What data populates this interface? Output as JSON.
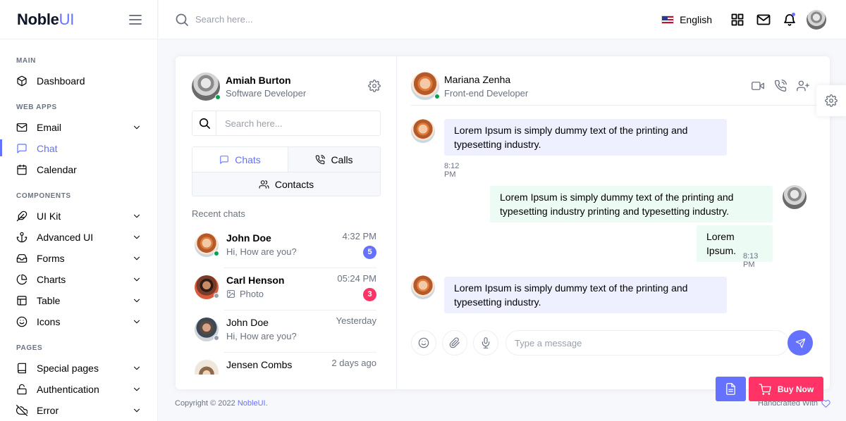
{
  "brand": {
    "name": "Noble",
    "suffix": "UI"
  },
  "sidebar": {
    "sections": [
      {
        "title": "MAIN",
        "items": [
          {
            "label": "Dashboard",
            "icon": "box-icon",
            "chevron": false
          }
        ]
      },
      {
        "title": "WEB APPS",
        "items": [
          {
            "label": "Email",
            "icon": "mail-icon",
            "chevron": true
          },
          {
            "label": "Chat",
            "icon": "message-square-icon",
            "chevron": false,
            "active": true
          },
          {
            "label": "Calendar",
            "icon": "calendar-icon",
            "chevron": false
          }
        ]
      },
      {
        "title": "COMPONENTS",
        "items": [
          {
            "label": "UI Kit",
            "icon": "feather-icon",
            "chevron": true
          },
          {
            "label": "Advanced UI",
            "icon": "anchor-icon",
            "chevron": true
          },
          {
            "label": "Forms",
            "icon": "inbox-icon",
            "chevron": true
          },
          {
            "label": "Charts",
            "icon": "pie-chart-icon",
            "chevron": true
          },
          {
            "label": "Table",
            "icon": "layout-icon",
            "chevron": true
          },
          {
            "label": "Icons",
            "icon": "smile-icon",
            "chevron": true
          }
        ]
      },
      {
        "title": "PAGES",
        "items": [
          {
            "label": "Special pages",
            "icon": "book-icon",
            "chevron": true
          },
          {
            "label": "Authentication",
            "icon": "unlock-icon",
            "chevron": true
          },
          {
            "label": "Error",
            "icon": "cloud-off-icon",
            "chevron": true
          }
        ]
      }
    ]
  },
  "topbar": {
    "search_placeholder": "Search here...",
    "language": "English"
  },
  "profile": {
    "name": "Amiah Burton",
    "role": "Software Developer"
  },
  "chat_search": {
    "placeholder": "Search here..."
  },
  "tabs": {
    "chats": "Chats",
    "calls": "Calls",
    "contacts": "Contacts"
  },
  "recent_label": "Recent chats",
  "chats": [
    {
      "name": "John Doe",
      "message": "Hi, How are you?",
      "time": "4:32 PM",
      "badge": "5",
      "badge_color": "#6571ff",
      "bold": true,
      "online": true,
      "avatar": "av-woman",
      "photo": false
    },
    {
      "name": "Carl Henson",
      "message": "Photo",
      "time": "05:24 PM",
      "badge": "3",
      "badge_color": "#ff3366",
      "bold": true,
      "online": false,
      "avatar": "av-man",
      "photo": true
    },
    {
      "name": "John Doe",
      "message": "Hi, How are you?",
      "time": "Yesterday",
      "badge": "",
      "badge_color": "",
      "bold": false,
      "online": false,
      "avatar": "av-man2",
      "photo": false
    },
    {
      "name": "Jensen Combs",
      "message": "",
      "time": "2 days ago",
      "badge": "",
      "badge_color": "",
      "bold": false,
      "online": false,
      "avatar": "av-man3",
      "photo": false
    }
  ],
  "contact": {
    "name": "Mariana Zenha",
    "role": "Front-end Developer"
  },
  "messages": [
    {
      "text": "Lorem Ipsum is simply dummy text of the printing and typesetting industry.",
      "time": "8:12 PM",
      "from": "them"
    },
    {
      "text": "Lorem Ipsum is simply dummy text of the printing and typesetting industry printing and typesetting industry.",
      "time": "",
      "from": "me"
    },
    {
      "text": "Lorem Ipsum.",
      "time": "8:13 PM",
      "from": "me"
    },
    {
      "text": "Lorem Ipsum is simply dummy text of the printing and typesetting industry.",
      "time": "",
      "from": "them"
    }
  ],
  "composer": {
    "placeholder": "Type a message"
  },
  "footer": {
    "copyright": "Copyright © 2022",
    "brand_link": "NobleUI",
    "dot": ".",
    "handcrafted": "Handcrafted With"
  },
  "buy_now": "Buy Now",
  "colors": {
    "accent": "#6571ff",
    "danger": "#ff3366",
    "success": "#05a34a"
  }
}
